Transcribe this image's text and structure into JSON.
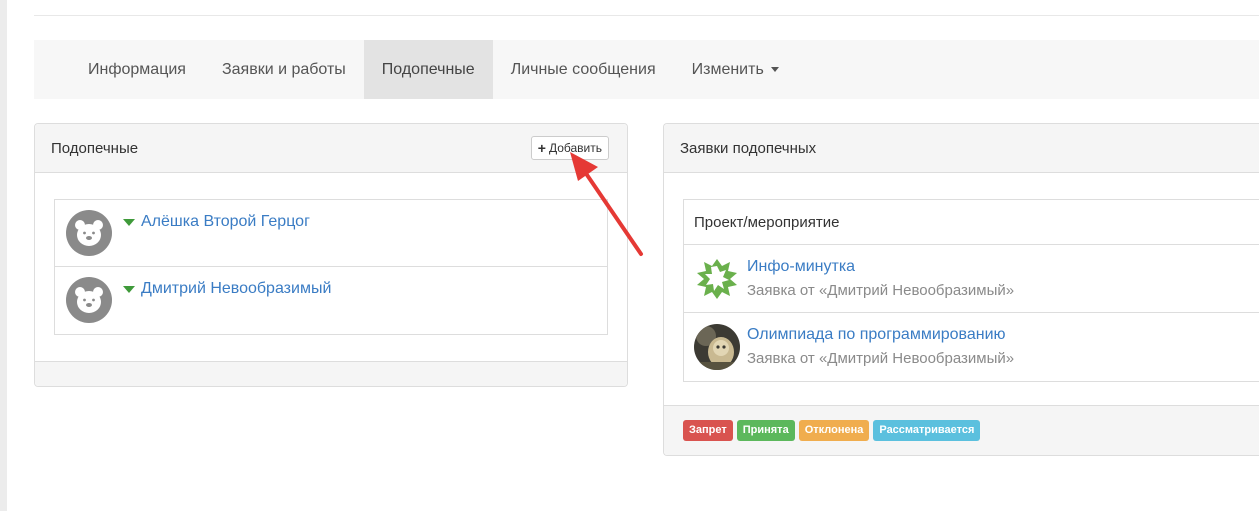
{
  "nav": {
    "tabs": [
      {
        "label": "Информация"
      },
      {
        "label": "Заявки и работы"
      },
      {
        "label": "Подопечные",
        "active": true
      },
      {
        "label": "Личные сообщения"
      },
      {
        "label": "Изменить"
      }
    ]
  },
  "wards_panel": {
    "title": "Подопечные",
    "add_label": "Добавить",
    "items": [
      {
        "name": "Алёшка Второй Герцог",
        "avatar_icon": "bear-avatar-icon"
      },
      {
        "name": "Дмитрий Невообразимый",
        "avatar_icon": "bear-avatar-icon"
      }
    ]
  },
  "requests_panel": {
    "title": "Заявки подопечных",
    "column_header": "Проект/мероприятие",
    "rows": [
      {
        "title": "Инфо-минутка",
        "subtitle": "Заявка от «Дмитрий Невообразимый»",
        "logo_icon": "leaf-logo-icon"
      },
      {
        "title": "Олимпиада по программированию",
        "subtitle": "Заявка от «Дмитрий Невообразимый»",
        "logo_icon": "photo-logo-icon"
      }
    ],
    "legend": [
      {
        "label": "Запрет",
        "color": "#d9534f"
      },
      {
        "label": "Принята",
        "color": "#5cb85c"
      },
      {
        "label": "Отклонена",
        "color": "#f0ad4e"
      },
      {
        "label": "Рассматривается",
        "color": "#5bc0de"
      }
    ]
  },
  "colors": {
    "link": "#3a7cc4",
    "triangle": "#3f9a3a",
    "annotation_arrow": "#e53935"
  }
}
